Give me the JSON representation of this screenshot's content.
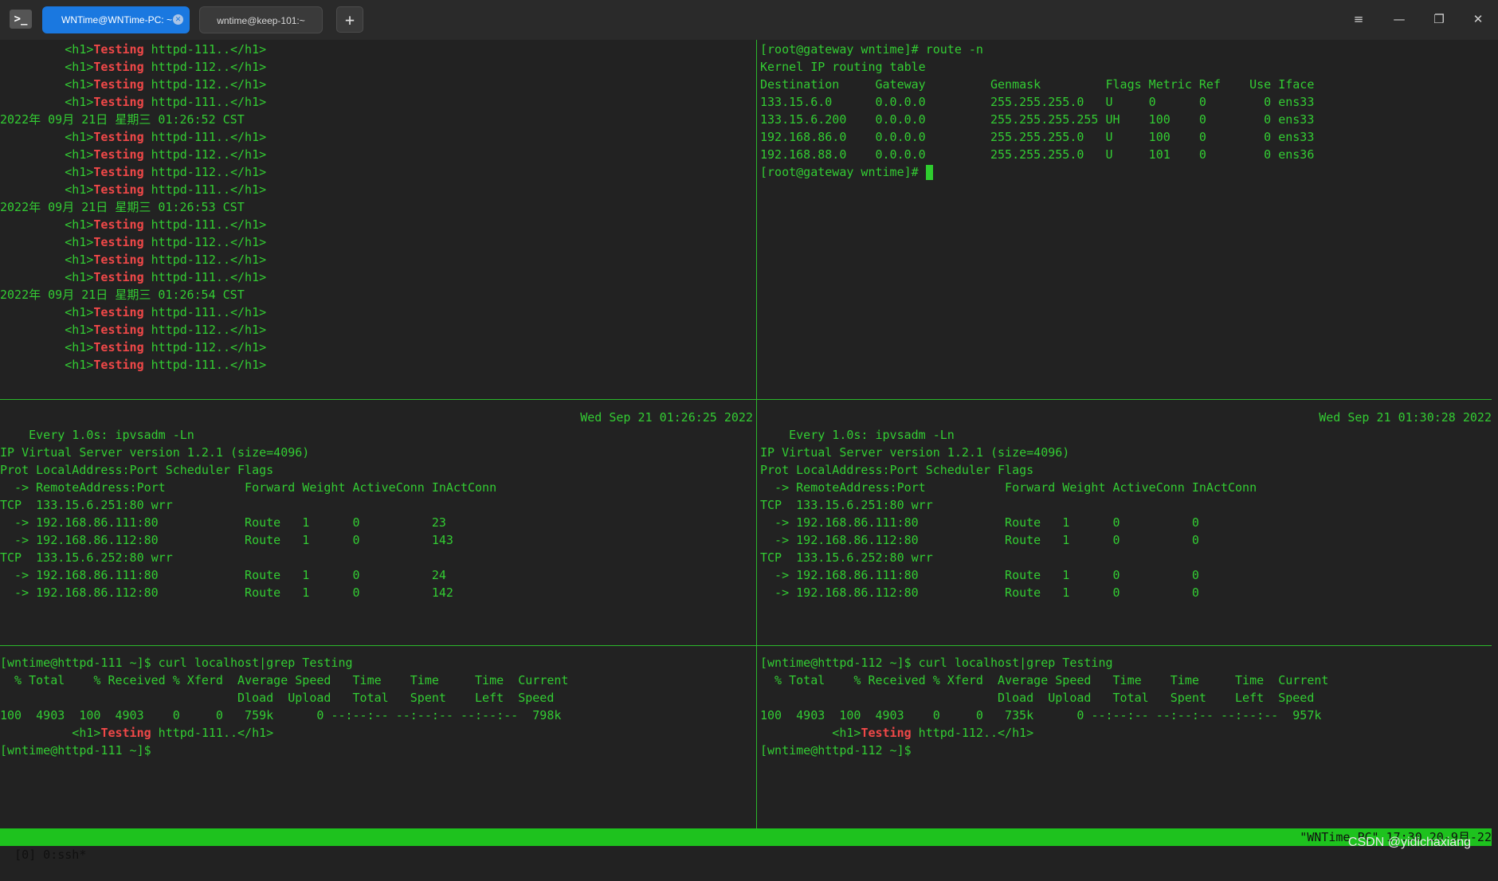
{
  "titlebar": {
    "app_icon": "terminal-icon",
    "tabs": [
      {
        "label": "WNTime@WNTime-PC: ~"
      },
      {
        "label": "wntime@keep-101:~"
      }
    ],
    "new_tab": "+",
    "menu_icon": "≡",
    "minimize_icon": "—",
    "restore_icon": "❐",
    "close_icon": "✕"
  },
  "panes": {
    "top_left": [
      {
        "pre": "         <h1>",
        "hl": "Testing",
        "post": " httpd-111..</h1>"
      },
      {
        "pre": "         <h1>",
        "hl": "Testing",
        "post": " httpd-112..</h1>"
      },
      {
        "pre": "         <h1>",
        "hl": "Testing",
        "post": " httpd-112..</h1>"
      },
      {
        "pre": "         <h1>",
        "hl": "Testing",
        "post": " httpd-111..</h1>"
      },
      {
        "pre": "2022年 09月 21日 星期三 01:26:52 CST",
        "hl": "",
        "post": ""
      },
      {
        "pre": "         <h1>",
        "hl": "Testing",
        "post": " httpd-111..</h1>"
      },
      {
        "pre": "         <h1>",
        "hl": "Testing",
        "post": " httpd-112..</h1>"
      },
      {
        "pre": "         <h1>",
        "hl": "Testing",
        "post": " httpd-112..</h1>"
      },
      {
        "pre": "         <h1>",
        "hl": "Testing",
        "post": " httpd-111..</h1>"
      },
      {
        "pre": "2022年 09月 21日 星期三 01:26:53 CST",
        "hl": "",
        "post": ""
      },
      {
        "pre": "         <h1>",
        "hl": "Testing",
        "post": " httpd-111..</h1>"
      },
      {
        "pre": "         <h1>",
        "hl": "Testing",
        "post": " httpd-112..</h1>"
      },
      {
        "pre": "         <h1>",
        "hl": "Testing",
        "post": " httpd-112..</h1>"
      },
      {
        "pre": "         <h1>",
        "hl": "Testing",
        "post": " httpd-111..</h1>"
      },
      {
        "pre": "2022年 09月 21日 星期三 01:26:54 CST",
        "hl": "",
        "post": ""
      },
      {
        "pre": "         <h1>",
        "hl": "Testing",
        "post": " httpd-111..</h1>"
      },
      {
        "pre": "         <h1>",
        "hl": "Testing",
        "post": " httpd-112..</h1>"
      },
      {
        "pre": "         <h1>",
        "hl": "Testing",
        "post": " httpd-112..</h1>"
      },
      {
        "pre": "         <h1>",
        "hl": "Testing",
        "post": " httpd-111..</h1>"
      }
    ],
    "top_right": [
      "[root@gateway wntime]# route -n",
      "Kernel IP routing table",
      "Destination     Gateway         Genmask         Flags Metric Ref    Use Iface",
      "133.15.6.0      0.0.0.0         255.255.255.0   U     0      0        0 ens33",
      "133.15.6.200    0.0.0.0         255.255.255.255 UH    100    0        0 ens33",
      "192.168.86.0    0.0.0.0         255.255.255.0   U     100    0        0 ens33",
      "192.168.88.0    0.0.0.0         255.255.255.0   U     101    0        0 ens36"
    ],
    "top_right_prompt": "[root@gateway wntime]# ",
    "mid_left": {
      "header_left": "Every 1.0s: ipvsadm -Ln",
      "header_right": "Wed Sep 21 01:26:25 2022",
      "lines": [
        "",
        "IP Virtual Server version 1.2.1 (size=4096)",
        "Prot LocalAddress:Port Scheduler Flags",
        "  -> RemoteAddress:Port           Forward Weight ActiveConn InActConn",
        "TCP  133.15.6.251:80 wrr",
        "  -> 192.168.86.111:80            Route   1      0          23",
        "  -> 192.168.86.112:80            Route   1      0          143",
        "TCP  133.15.6.252:80 wrr",
        "  -> 192.168.86.111:80            Route   1      0          24",
        "  -> 192.168.86.112:80            Route   1      0          142"
      ]
    },
    "mid_right": {
      "header_left": "Every 1.0s: ipvsadm -Ln",
      "header_right": "Wed Sep 21 01:30:28 2022",
      "lines": [
        "",
        "IP Virtual Server version 1.2.1 (size=4096)",
        "Prot LocalAddress:Port Scheduler Flags",
        "  -> RemoteAddress:Port           Forward Weight ActiveConn InActConn",
        "TCP  133.15.6.251:80 wrr",
        "  -> 192.168.86.111:80            Route   1      0          0",
        "  -> 192.168.86.112:80            Route   1      0          0",
        "TCP  133.15.6.252:80 wrr",
        "  -> 192.168.86.111:80            Route   1      0          0",
        "  -> 192.168.86.112:80            Route   1      0          0"
      ]
    },
    "bottom_left": [
      {
        "pre": "[wntime@httpd-111 ~]$ curl localhost|grep Testing",
        "hl": "",
        "post": ""
      },
      {
        "pre": "  % Total    % Received % Xferd  Average Speed   Time    Time     Time  Current",
        "hl": "",
        "post": ""
      },
      {
        "pre": "                                 Dload  Upload   Total   Spent    Left  Speed",
        "hl": "",
        "post": ""
      },
      {
        "pre": "100  4903  100  4903    0     0   759k      0 --:--:-- --:--:-- --:--:--  798k",
        "hl": "",
        "post": ""
      },
      {
        "pre": "          <h1>",
        "hl": "Testing",
        "post": " httpd-111..</h1>"
      },
      {
        "pre": "[wntime@httpd-111 ~]$",
        "hl": "",
        "post": ""
      }
    ],
    "bottom_right": [
      {
        "pre": "[wntime@httpd-112 ~]$ curl localhost|grep Testing",
        "hl": "",
        "post": ""
      },
      {
        "pre": "  % Total    % Received % Xferd  Average Speed   Time    Time     Time  Current",
        "hl": "",
        "post": ""
      },
      {
        "pre": "                                 Dload  Upload   Total   Spent    Left  Speed",
        "hl": "",
        "post": ""
      },
      {
        "pre": "100  4903  100  4903    0     0   735k      0 --:--:-- --:--:-- --:--:--  957k",
        "hl": "",
        "post": ""
      },
      {
        "pre": "          <h1>",
        "hl": "Testing",
        "post": " httpd-112..</h1>"
      },
      {
        "pre": "[wntime@httpd-112 ~]$",
        "hl": "",
        "post": ""
      }
    ]
  },
  "statusbar": {
    "left": "[0] 0:ssh*",
    "right": "\"WNTime-PC\" 17:30 20-9月-22"
  },
  "watermark": "CSDN @yidichaxiang",
  "colors": {
    "background": "#222222",
    "terminal_green": "#33cc33",
    "highlight_red": "#f04848",
    "status_green": "#1ec21e",
    "active_tab": "#1a78e0"
  }
}
